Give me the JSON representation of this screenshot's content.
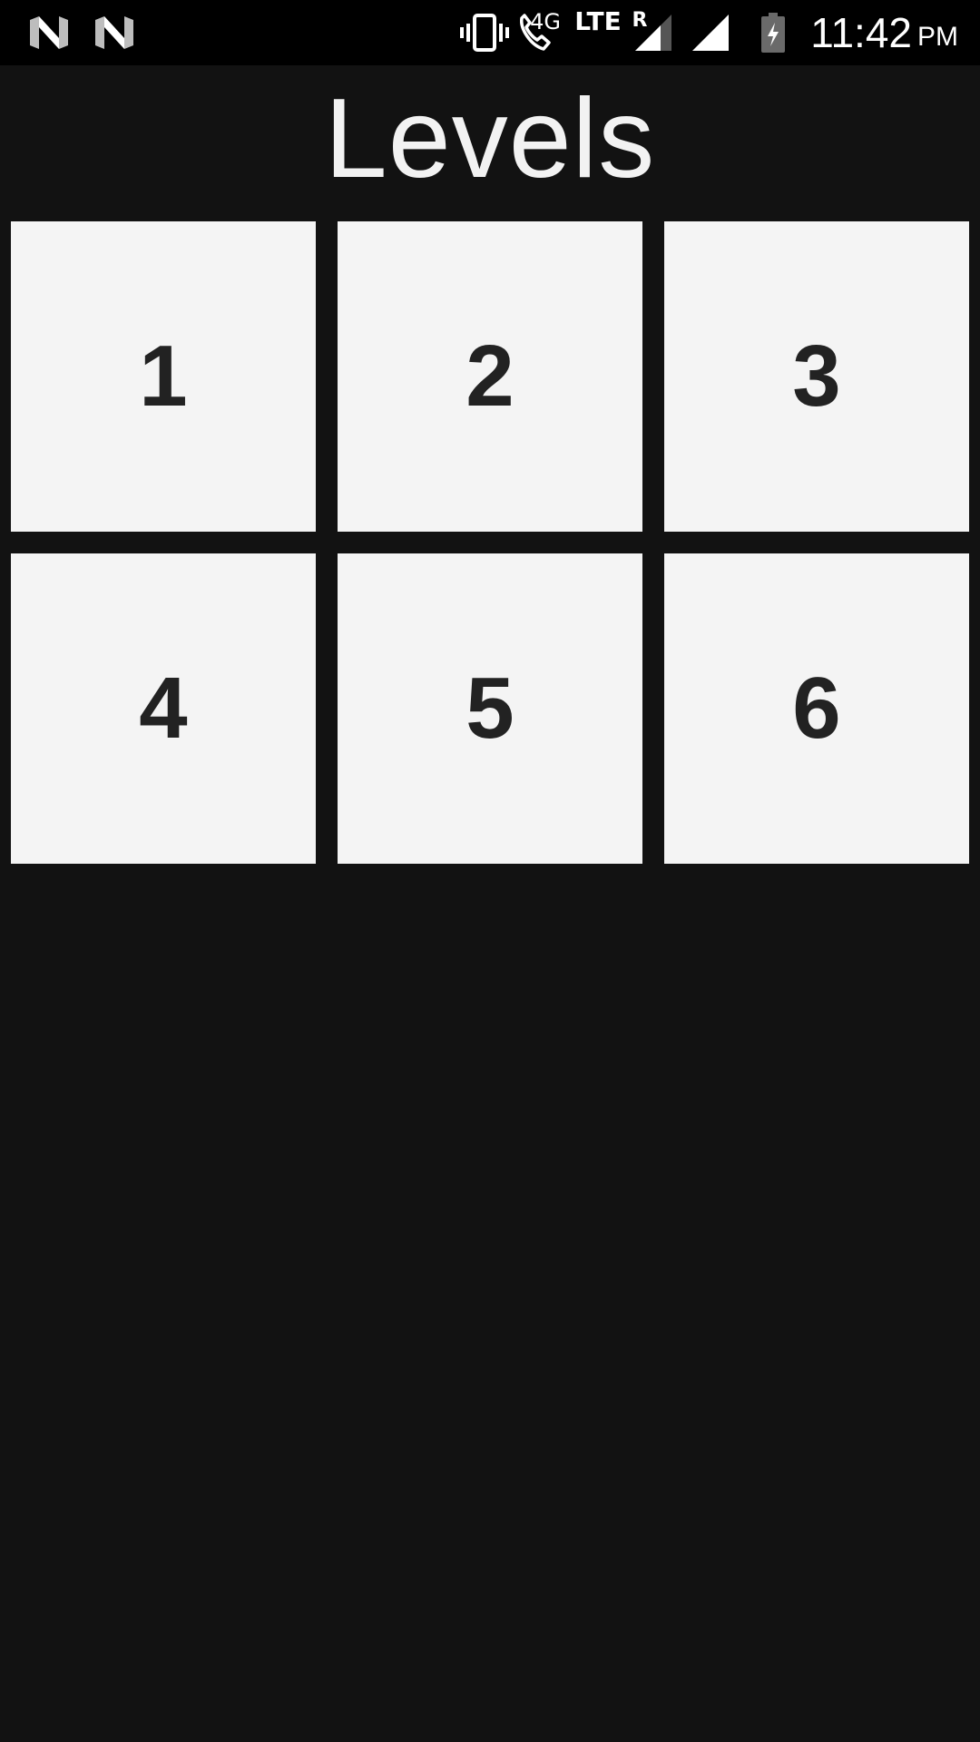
{
  "status_bar": {
    "left_icons": [
      "n-notification-icon",
      "n-notification-icon"
    ],
    "network_4g": "4G",
    "network_lte": "LTE",
    "roaming": "R",
    "time": "11:42",
    "ampm": "PM",
    "icons": [
      "vibrate-icon",
      "wifi-calling-icon",
      "signal-roaming-icon",
      "signal-icon",
      "battery-charging-icon"
    ]
  },
  "title": "Levels",
  "levels": [
    {
      "label": "1"
    },
    {
      "label": "2"
    },
    {
      "label": "3"
    },
    {
      "label": "4"
    },
    {
      "label": "5"
    },
    {
      "label": "6"
    }
  ],
  "colors": {
    "background": "#121212",
    "status_bar": "#000000",
    "tile": "#f4f4f4",
    "tile_text": "#222222",
    "title_text": "#f2f2f2"
  }
}
